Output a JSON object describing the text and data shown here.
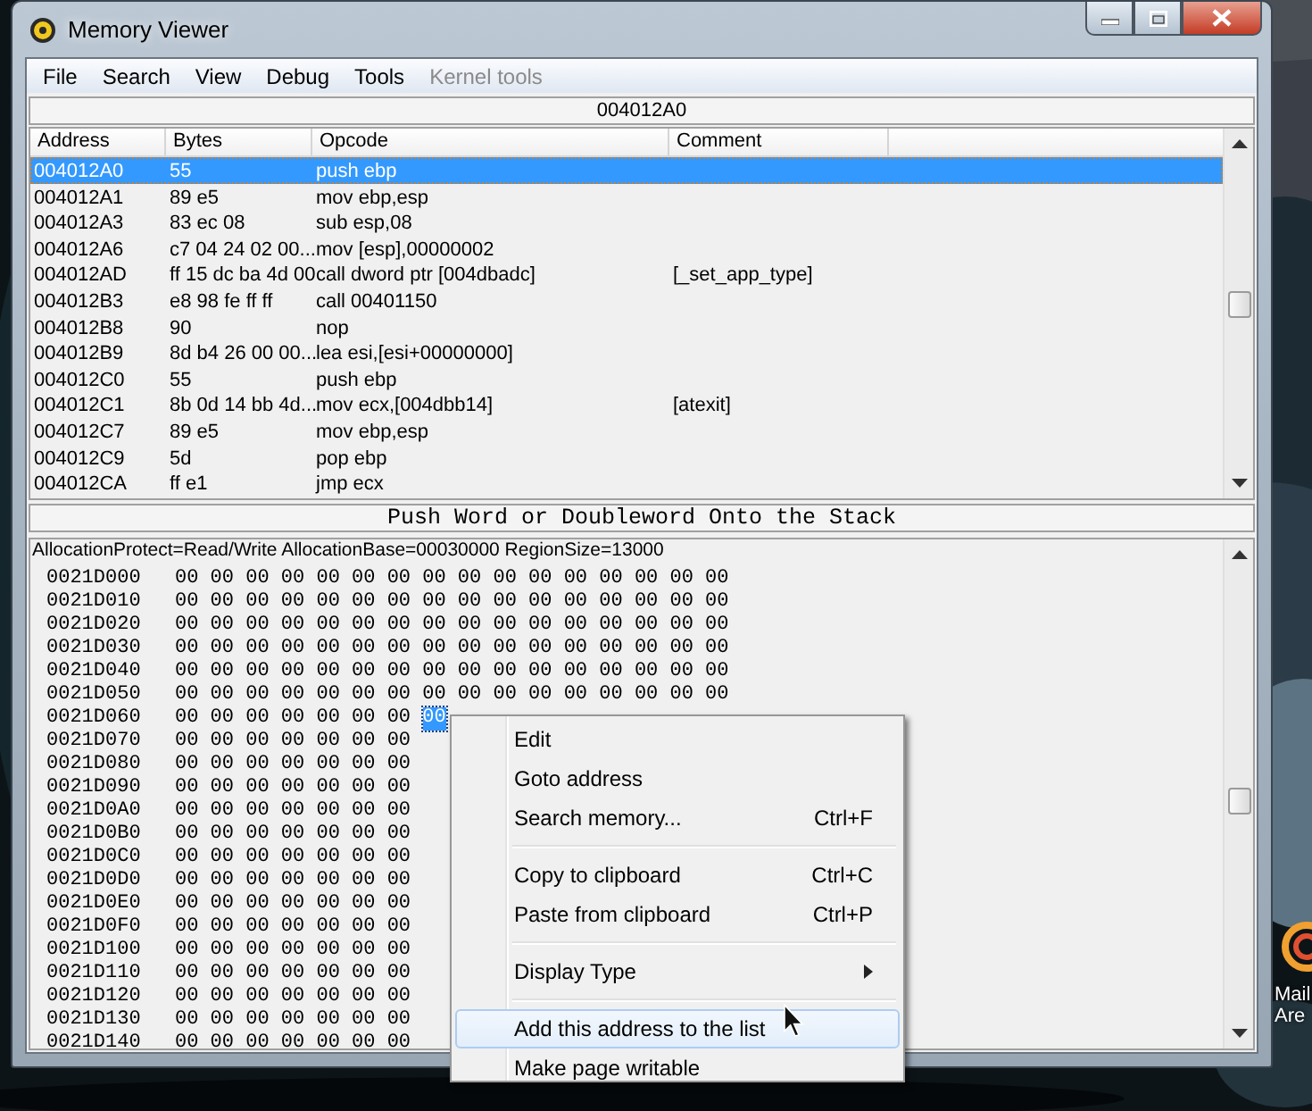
{
  "window": {
    "title": "Memory Viewer"
  },
  "menu_bar": [
    {
      "label": "File",
      "disabled": false
    },
    {
      "label": "Search",
      "disabled": false
    },
    {
      "label": "View",
      "disabled": false
    },
    {
      "label": "Debug",
      "disabled": false
    },
    {
      "label": "Tools",
      "disabled": false
    },
    {
      "label": "Kernel tools",
      "disabled": true
    }
  ],
  "address_bar": {
    "value": "004012A0"
  },
  "disassembly": {
    "columns": [
      "Address",
      "Bytes",
      "Opcode",
      "Comment"
    ],
    "rows": [
      {
        "address": "004012A0",
        "bytes": "55",
        "opcode": "push ebp",
        "selected": true
      },
      {
        "address": "004012A1",
        "bytes": "89 e5",
        "opcode": "mov ebp,esp",
        "selected": false
      },
      {
        "address": "004012A3",
        "bytes": "83 ec 08",
        "opcode": "sub esp,08",
        "selected": false
      },
      {
        "address": "004012A6",
        "bytes": "c7 04 24 02 00...",
        "opcode": "mov [esp],00000002",
        "selected": false
      },
      {
        "address": "004012AD",
        "bytes": "ff 15 dc ba 4d 00",
        "opcode": "call dword ptr [004dbadc]",
        "comment": "[_set_app_type]",
        "selected": false
      },
      {
        "address": "004012B3",
        "bytes": "e8 98 fe ff ff",
        "opcode": "call 00401150",
        "selected": false
      },
      {
        "address": "004012B8",
        "bytes": "90",
        "opcode": "nop",
        "selected": false
      },
      {
        "address": "004012B9",
        "bytes": "8d b4 26 00 00...",
        "opcode": "lea esi,[esi+00000000]",
        "selected": false
      },
      {
        "address": "004012C0",
        "bytes": "55",
        "opcode": "push ebp",
        "selected": false
      },
      {
        "address": "004012C1",
        "bytes": "8b 0d 14 bb 4d...",
        "opcode": "mov ecx,[004dbb14]",
        "comment": "[atexit]",
        "selected": false
      },
      {
        "address": "004012C7",
        "bytes": "89 e5",
        "opcode": "mov ebp,esp",
        "selected": false
      },
      {
        "address": "004012C9",
        "bytes": "5d",
        "opcode": "pop ebp",
        "selected": false
      },
      {
        "address": "004012CA",
        "bytes": "ff e1",
        "opcode": "jmp ecx",
        "selected": false
      }
    ]
  },
  "instruction_description": "Push Word or Doubleword Onto the Stack",
  "hex_view": {
    "info": "AllocationProtect=Read/Write  AllocationBase=00030000 RegionSize=13000",
    "rows": [
      {
        "address": "0021D000",
        "bytes": "00 00 00 00 00 00 00 00 00 00 00 00 00 00 00 00"
      },
      {
        "address": "0021D010",
        "bytes": "00 00 00 00 00 00 00 00 00 00 00 00 00 00 00 00"
      },
      {
        "address": "0021D020",
        "bytes": "00 00 00 00 00 00 00 00 00 00 00 00 00 00 00 00"
      },
      {
        "address": "0021D030",
        "bytes": "00 00 00 00 00 00 00 00 00 00 00 00 00 00 00 00"
      },
      {
        "address": "0021D040",
        "bytes": "00 00 00 00 00 00 00 00 00 00 00 00 00 00 00 00"
      },
      {
        "address": "0021D050",
        "bytes": "00 00 00 00 00 00 00 00 00 00 00 00 00 00 00 00"
      },
      {
        "address": "0021D060",
        "bytes": "00 00 00 00 00 00 00",
        "selected_byte": "00"
      },
      {
        "address": "0021D070",
        "bytes": "00 00 00 00 00 00 00"
      },
      {
        "address": "0021D080",
        "bytes": "00 00 00 00 00 00 00"
      },
      {
        "address": "0021D090",
        "bytes": "00 00 00 00 00 00 00"
      },
      {
        "address": "0021D0A0",
        "bytes": "00 00 00 00 00 00 00"
      },
      {
        "address": "0021D0B0",
        "bytes": "00 00 00 00 00 00 00"
      },
      {
        "address": "0021D0C0",
        "bytes": "00 00 00 00 00 00 00"
      },
      {
        "address": "0021D0D0",
        "bytes": "00 00 00 00 00 00 00"
      },
      {
        "address": "0021D0E0",
        "bytes": "00 00 00 00 00 00 00"
      },
      {
        "address": "0021D0F0",
        "bytes": "00 00 00 00 00 00 00"
      },
      {
        "address": "0021D100",
        "bytes": "00 00 00 00 00 00 00"
      },
      {
        "address": "0021D110",
        "bytes": "00 00 00 00 00 00 00"
      },
      {
        "address": "0021D120",
        "bytes": "00 00 00 00 00 00 00"
      },
      {
        "address": "0021D130",
        "bytes": "00 00 00 00 00 00 00"
      },
      {
        "address": "0021D140",
        "bytes": "00 00 00 00 00 00 00"
      }
    ]
  },
  "context_menu": {
    "items": [
      {
        "kind": "item",
        "label": "Edit",
        "selected": false
      },
      {
        "kind": "item",
        "label": "Goto address",
        "selected": false
      },
      {
        "kind": "item",
        "label": "Search memory...",
        "shortcut": "Ctrl+F",
        "selected": false
      },
      {
        "kind": "separator"
      },
      {
        "kind": "item",
        "label": "Copy to clipboard",
        "shortcut": "Ctrl+C",
        "selected": false
      },
      {
        "kind": "item",
        "label": "Paste from clipboard",
        "shortcut": "Ctrl+P",
        "selected": false
      },
      {
        "kind": "separator"
      },
      {
        "kind": "submenu",
        "label": "Display Type",
        "selected": false
      },
      {
        "kind": "separator"
      },
      {
        "kind": "item",
        "label": "Add this address to the list",
        "selected": true
      },
      {
        "kind": "item",
        "label": "Make page writable",
        "selected": false
      }
    ]
  },
  "desktop_icon": {
    "label_lines": [
      "Mail",
      "Are"
    ]
  }
}
